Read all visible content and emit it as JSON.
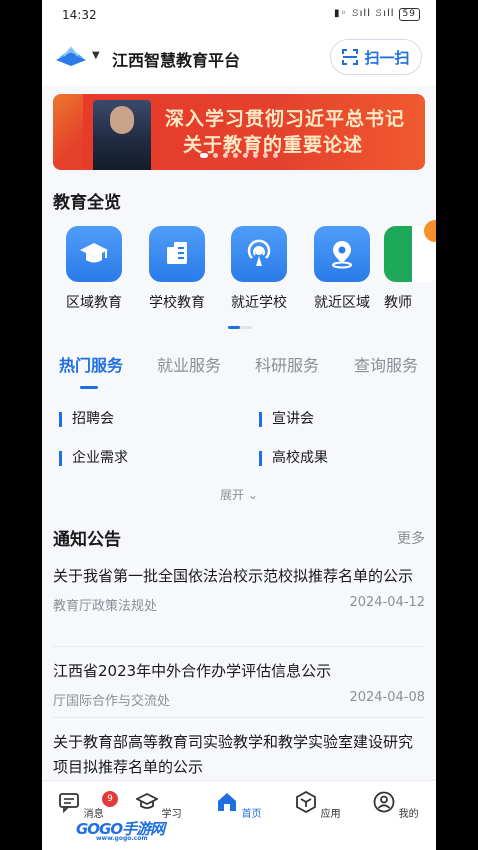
{
  "status_bar": {
    "time": "14:32",
    "battery": "59"
  },
  "header": {
    "title": "江西智慧教育平台",
    "scan_label": "扫一扫"
  },
  "banner": {
    "line1": "深入学习贯彻习近平总书记",
    "line2": "关于教育的重要论述"
  },
  "overview": {
    "title": "教育全览",
    "items": [
      {
        "label": "区域教育",
        "icon": "graduation-cap-icon"
      },
      {
        "label": "学校教育",
        "icon": "building-icon"
      },
      {
        "label": "就近学校",
        "icon": "broadcast-icon"
      },
      {
        "label": "就近区域",
        "icon": "location-pin-icon"
      },
      {
        "label": "教师",
        "icon": "teacher-icon"
      }
    ]
  },
  "service_tabs": [
    "热门服务",
    "就业服务",
    "科研服务",
    "查询服务"
  ],
  "services": [
    "招聘会",
    "宣讲会",
    "企业需求",
    "高校成果"
  ],
  "expand_label": "展开",
  "notices": {
    "title": "通知公告",
    "more": "更多",
    "items": [
      {
        "title": "关于我省第一批全国依法治校示范校拟推荐名单的公示",
        "source": "教育厅政策法规处",
        "date": "2024-04-12"
      },
      {
        "title": "江西省2023年中外合作办学评估信息公示",
        "source": "厅国际合作与交流处",
        "date": "2024-04-08"
      },
      {
        "title": "关于教育部高等教育司实验教学和教学实验室建设研究项目拟推荐名单的公示",
        "source": "",
        "date": ""
      }
    ]
  },
  "tabbar": {
    "items": [
      {
        "label": "消息",
        "badge": "9"
      },
      {
        "label": "学习"
      },
      {
        "label": "首页"
      },
      {
        "label": "应用"
      },
      {
        "label": "我的"
      }
    ]
  },
  "watermark": {
    "text": "GOGO手游网",
    "sub": "www.gogo.com"
  },
  "colors": {
    "accent": "#1f6fe0",
    "banner_red": "#e83a2a",
    "badge_red": "#e23b3b"
  }
}
